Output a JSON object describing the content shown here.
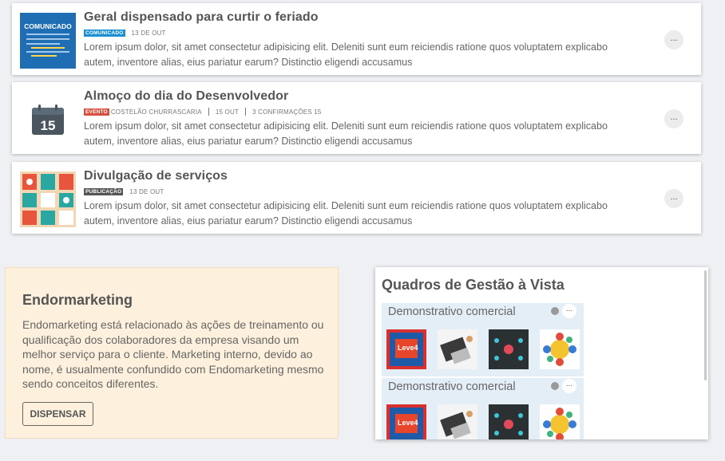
{
  "feed": [
    {
      "title": "Geral dispensado para curtir o feriado",
      "badge": "COMUNICADO",
      "date": "13 DE OUT",
      "desc": "Lorem ipsum dolor, sit amet consectetur adipisicing elit. Deleniti sunt eum reiciendis ratione quos voluptatem explicabo autem, inventore alias, eius pariatur earum? Distinctio eligendi accusamus",
      "more": "...",
      "thumb_title": "COMUNICADO"
    },
    {
      "title": "Almoço do dia do Desenvolvedor",
      "badge": "EVENTO",
      "place": "COSTELÃO CHURRASCARIA",
      "date": "15 OUT",
      "confirm": "3 CONFIRMAÇÕES 15",
      "desc": "Lorem ipsum dolor, sit amet consectetur adipisicing elit. Deleniti sunt eum reiciendis ratione quos voluptatem explicabo autem, inventore alias, eius pariatur earum? Distinctio eligendi accusamus",
      "more": "...",
      "cal_day": "15"
    },
    {
      "title": "Divulgação de serviços",
      "badge": "PUBLICAÇÃO",
      "date": "13 DE OUT",
      "desc": "Lorem ipsum dolor, sit amet consectetur adipisicing elit. Deleniti sunt eum reiciendis ratione quos voluptatem explicabo autem, inventore alias, eius pariatur earum? Distinctio eligendi accusamus",
      "more": "..."
    }
  ],
  "endo": {
    "title": "Endormarketing",
    "text": "Endomarketing está relacionado às ações de treinamento ou qualificação dos colaboradores da empresa visando um melhor serviço para o cliente. Marketing interno, devido ao nome, é usualmente confundido com Endomarketing mesmo sendo conceitos diferentes.",
    "button": "DISPENSAR"
  },
  "quadros": {
    "title": "Quadros de Gestão à Vista",
    "boards": [
      {
        "title": "Demonstrativo comercial",
        "more": "...",
        "tile_text": "Leve4"
      },
      {
        "title": "Demonstrativo comercial",
        "more": "...",
        "tile_text": "Leve4"
      }
    ]
  },
  "colors": {
    "accent_blue": "#1a8fd1",
    "event_red": "#d94f3d",
    "endo_bg": "#fdf0dc",
    "board_bg": "#e4eef7"
  },
  "icons": [
    "calendar-icon",
    "globe-icon"
  ]
}
